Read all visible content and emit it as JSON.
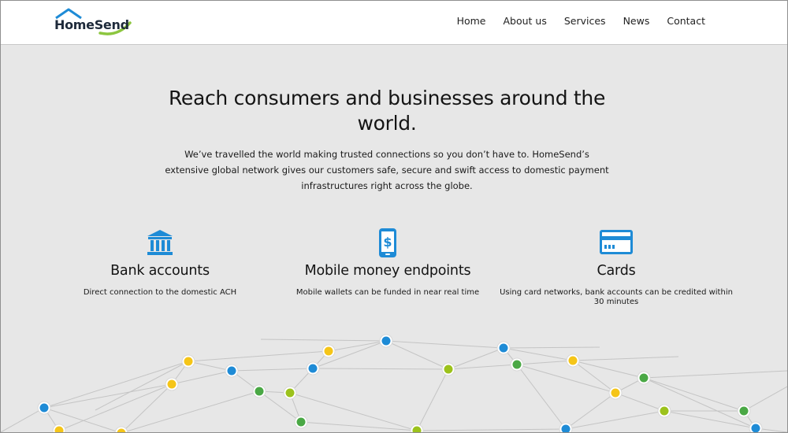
{
  "brand": {
    "name": "HomeSend",
    "colors": {
      "roof": "#1e8bd6",
      "swoosh": "#8cc63f",
      "text": "#1e2a3a",
      "accent_blue": "#1e8bd6"
    }
  },
  "nav": {
    "items": [
      {
        "label": "Home"
      },
      {
        "label": "About us"
      },
      {
        "label": "Services"
      },
      {
        "label": "News"
      },
      {
        "label": "Contact"
      }
    ]
  },
  "hero": {
    "title": "Reach consumers and businesses around the world.",
    "description": "We’ve travelled the world making trusted connections so you don’t have to. HomeSend’s extensive global network gives our customers safe, secure and swift access to domestic payment infrastructures right across the globe."
  },
  "features": [
    {
      "icon": "bank-icon",
      "title": "Bank accounts",
      "description": "Direct connection to the domestic ACH"
    },
    {
      "icon": "mobile-money-icon",
      "title": "Mobile money endpoints",
      "description": "Mobile wallets can be funded in near real time"
    },
    {
      "icon": "card-icon",
      "title": "Cards",
      "description": "Using card networks, bank accounts can be credited within 30 minutes"
    }
  ],
  "network": {
    "colors": {
      "blue": "#1e8bd6",
      "yellow": "#f5c518",
      "green": "#4aa845",
      "lime": "#9cc21c",
      "line": "#c4c4c4"
    }
  }
}
